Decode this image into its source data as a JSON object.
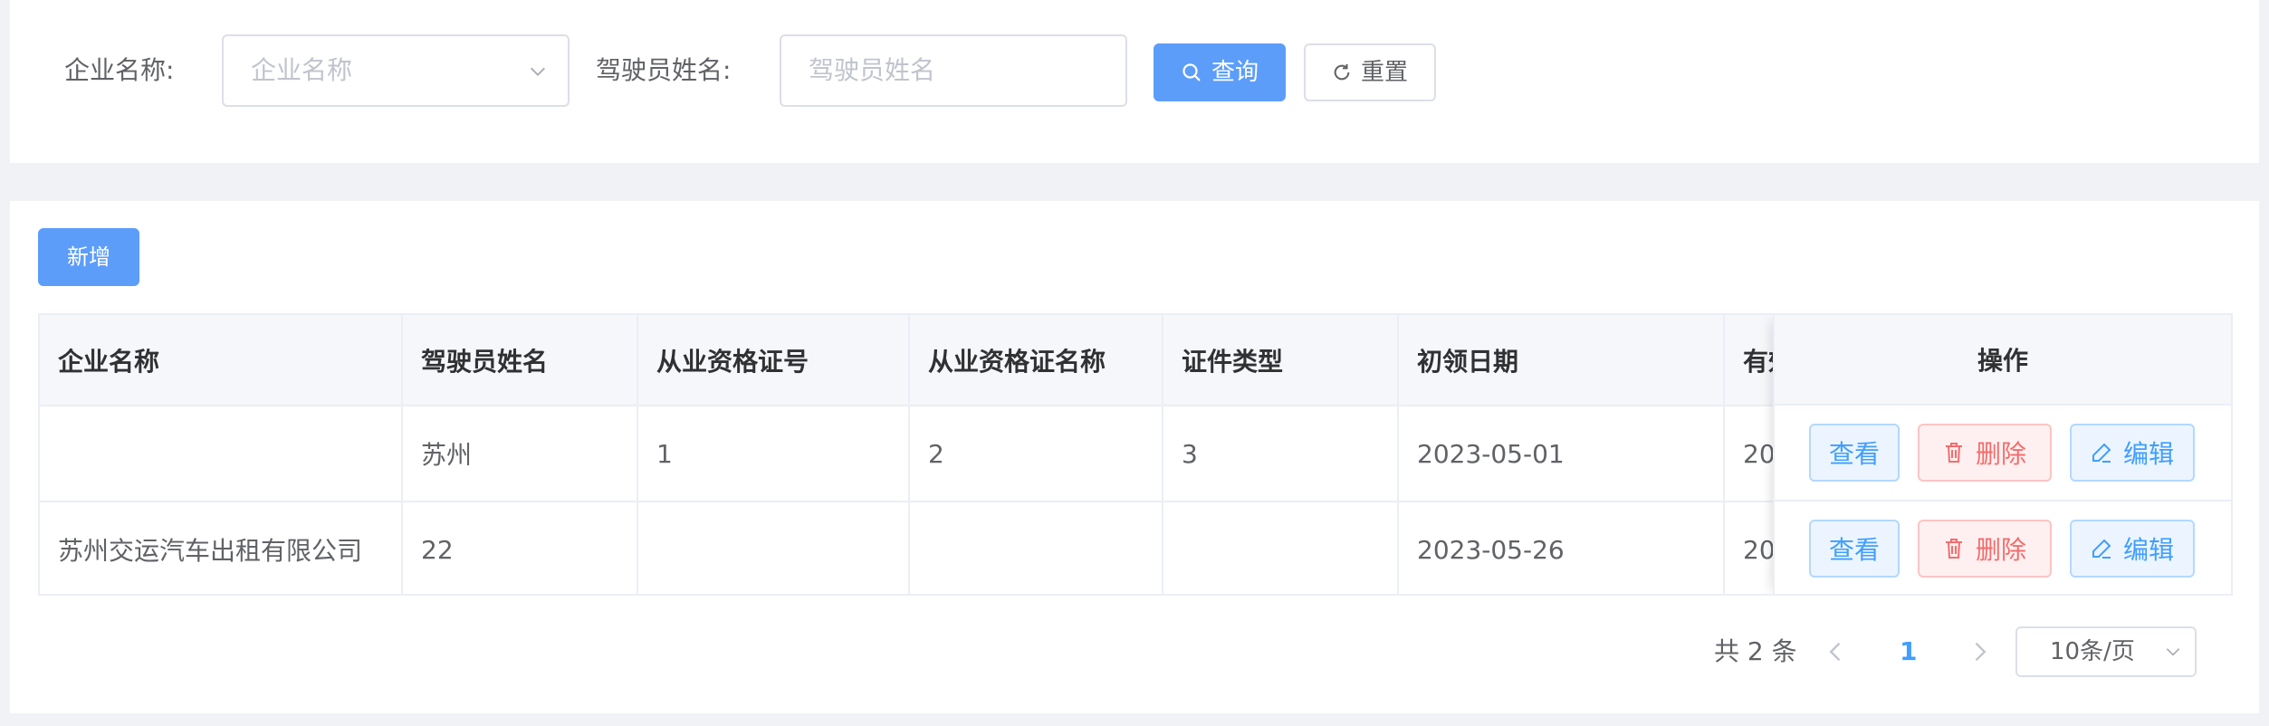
{
  "search": {
    "company_label": "企业名称:",
    "company_placeholder": "企业名称",
    "driver_label": "驾驶员姓名:",
    "driver_placeholder": "驾驶员姓名",
    "query_label": "查询",
    "reset_label": "重置"
  },
  "toolbar": {
    "add_label": "新增"
  },
  "table": {
    "columns": [
      "企业名称",
      "驾驶员姓名",
      "从业资格证号",
      "从业资格证名称",
      "证件类型",
      "初领日期",
      "有效"
    ],
    "fixed_column": "操作",
    "rows": [
      {
        "company": "",
        "driver": "苏州",
        "cert_no": "1",
        "cert_name": "2",
        "cert_type": "3",
        "first_date": "2023-05-01",
        "valid_partial": "20"
      },
      {
        "company": "苏州交运汽车出租有限公司",
        "driver": "22",
        "cert_no": "",
        "cert_name": "",
        "cert_type": "",
        "first_date": "2023-05-26",
        "valid_partial": "20"
      }
    ],
    "actions": {
      "view": "查看",
      "delete": "删除",
      "edit": "编辑"
    }
  },
  "pagination": {
    "total_text": "共 2 条",
    "current_page": "1",
    "page_size": "10条/页"
  },
  "colors": {
    "primary": "#5c9dfa",
    "link": "#409eff",
    "danger": "#f56c6c",
    "header_bg": "#f5f7fa",
    "page_bg": "#f0f2f5"
  },
  "icons": [
    "search-icon",
    "refresh-icon",
    "chevron-down-icon",
    "trash-icon",
    "edit-icon",
    "chevron-left-icon",
    "chevron-right-icon"
  ]
}
